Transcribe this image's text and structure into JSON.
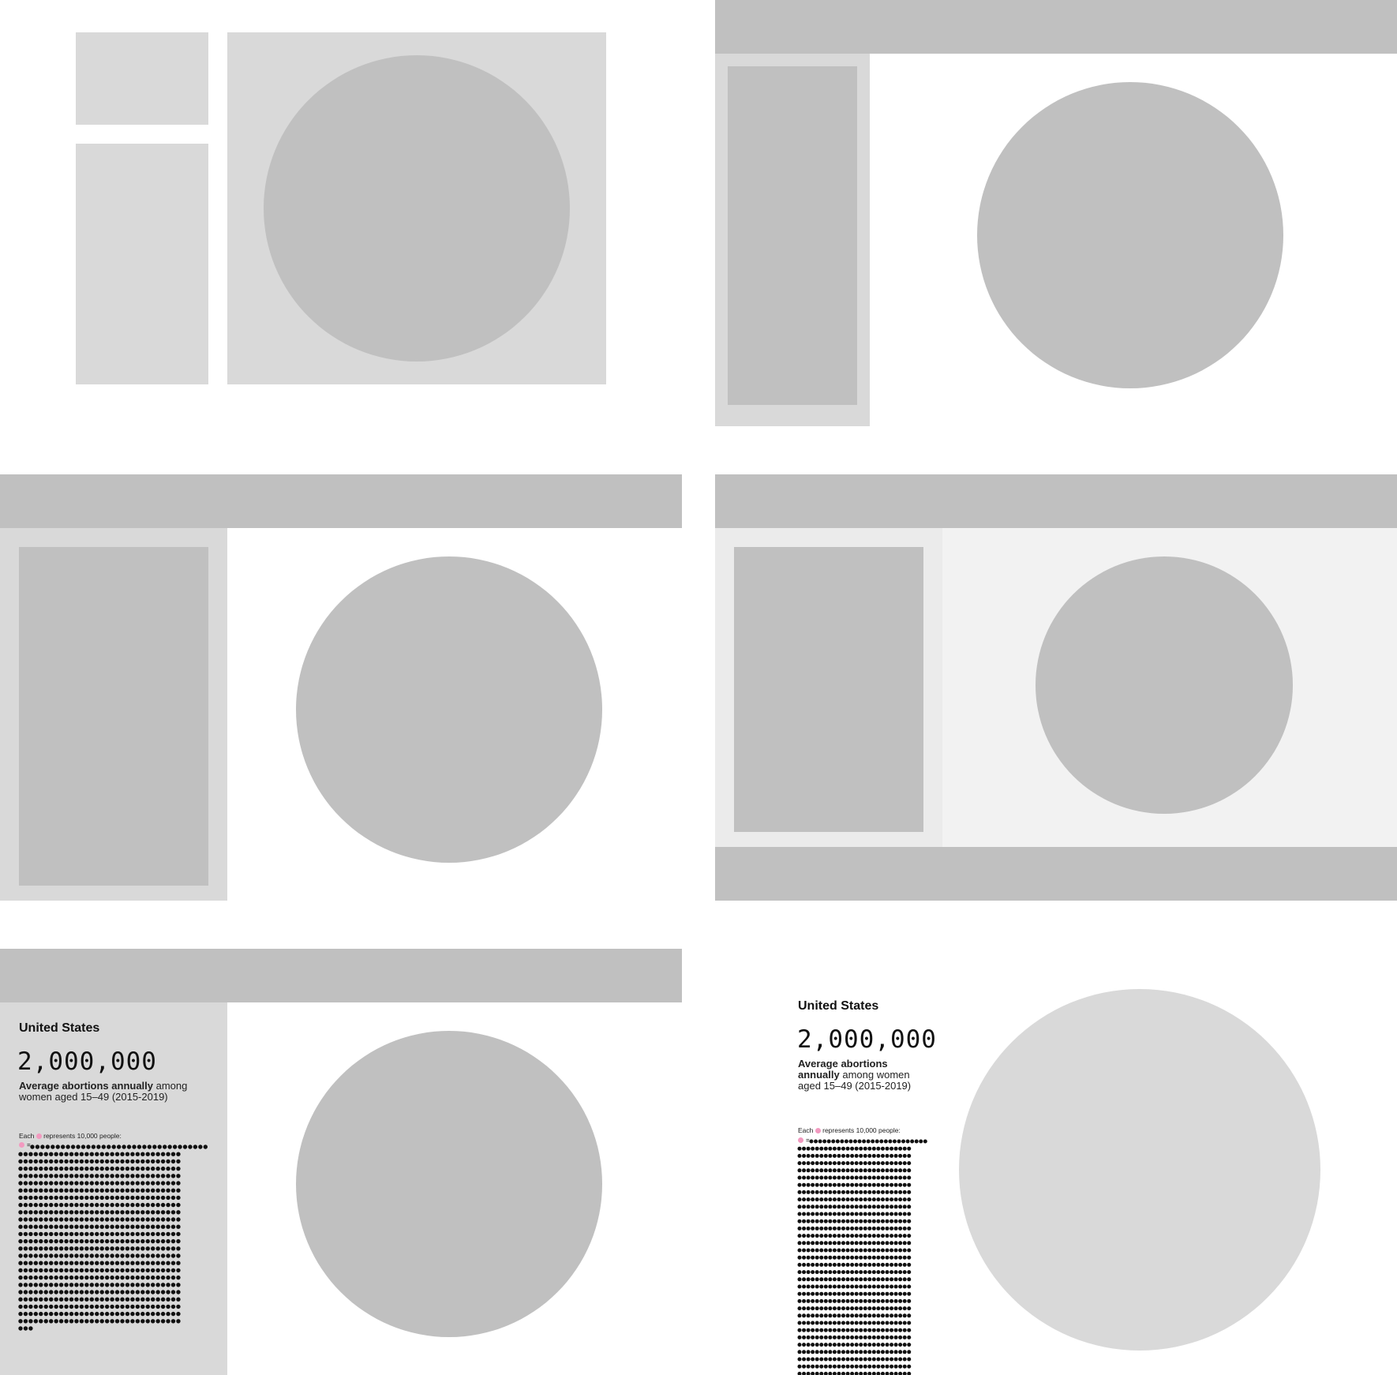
{
  "panel_e": {
    "country": "United States",
    "big_number": "2,000,000",
    "caption_bold": "Average abortions annually",
    "caption_rest": " among women aged 15–49 (2015-2019)",
    "unit_note_prefix": "Each",
    "unit_note_suffix": "represents 10,000 people:",
    "equals": "="
  },
  "panel_f": {
    "country": "United States",
    "big_number": "2,000,000",
    "caption_bold": "Average abortions annually",
    "caption_rest": " among women aged 15–49 (2015-2019)",
    "unit_note_prefix": "Each",
    "unit_note_suffix": "represents 10,000 people:",
    "equals": "="
  },
  "colors": {
    "placeholder_light": "#d9d9d9",
    "placeholder_mid": "#c0c0c0",
    "unit_icon": "#f29ac0",
    "dot": "#111111"
  },
  "icons": {
    "unit": "pink-person-dot-icon",
    "dot": "black-dot-icon"
  }
}
